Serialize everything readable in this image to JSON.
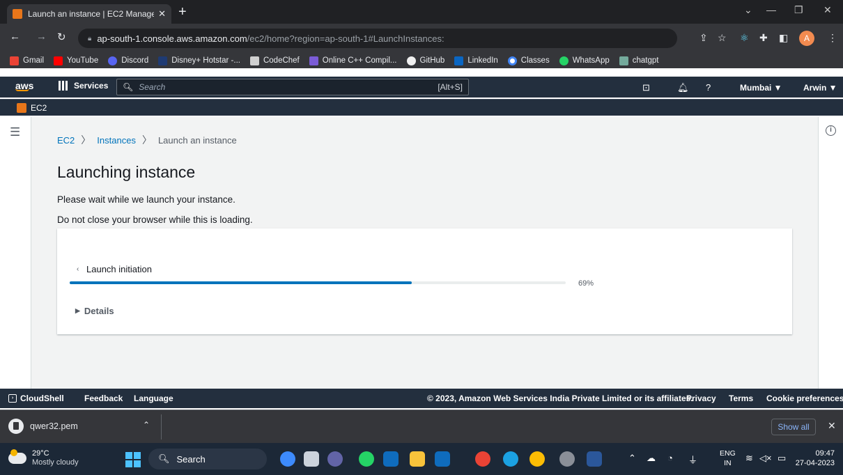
{
  "browser": {
    "tab_title": "Launch an instance | EC2 Manage",
    "new_tab": "+",
    "url_host": "ap-south-1.console.aws.amazon.com",
    "url_path": "/ec2/home?region=ap-south-1#LaunchInstances:",
    "profile_initial": "A",
    "bookmarks": [
      "Gmail",
      "YouTube",
      "Discord",
      "Disney+ Hotstar -...",
      "CodeChef",
      "Online C++ Compil...",
      "GitHub",
      "LinkedIn",
      "Classes",
      "WhatsApp",
      "chatgpt"
    ]
  },
  "aws_header": {
    "logo": "aws",
    "services_label": "Services",
    "search_placeholder": "Search",
    "search_shortcut": "[Alt+S]",
    "region": "Mumbai ▼",
    "user": "Arwin ▼",
    "service_name": "EC2"
  },
  "breadcrumb": {
    "item1": "EC2",
    "item2": "Instances",
    "current": "Launch an instance"
  },
  "page": {
    "title": "Launching instance",
    "message1": "Please wait while we launch your instance.",
    "message2": "Do not close your browser while this is loading."
  },
  "progress": {
    "step_label": "Launch initiation",
    "percent": 69,
    "percent_label": "69%",
    "details_label": "Details"
  },
  "footer": {
    "cloudshell": "CloudShell",
    "feedback": "Feedback",
    "language": "Language",
    "copyright": "© 2023, Amazon Web Services India Private Limited or its affiliates.",
    "privacy": "Privacy",
    "terms": "Terms",
    "cookies": "Cookie preferences"
  },
  "downloads": {
    "filename": "qwer32.pem",
    "show_all": "Show all"
  },
  "taskbar": {
    "temperature": "29°C",
    "weather": "Mostly cloudy",
    "search": "Search",
    "lang1": "ENG",
    "lang2": "IN",
    "time": "09:47",
    "date": "27-04-2023"
  },
  "colors": {
    "aws_nav": "#232f3e",
    "progress_fill": "#0073bb",
    "link": "#0073bb",
    "accent_orange": "#ff9900"
  }
}
